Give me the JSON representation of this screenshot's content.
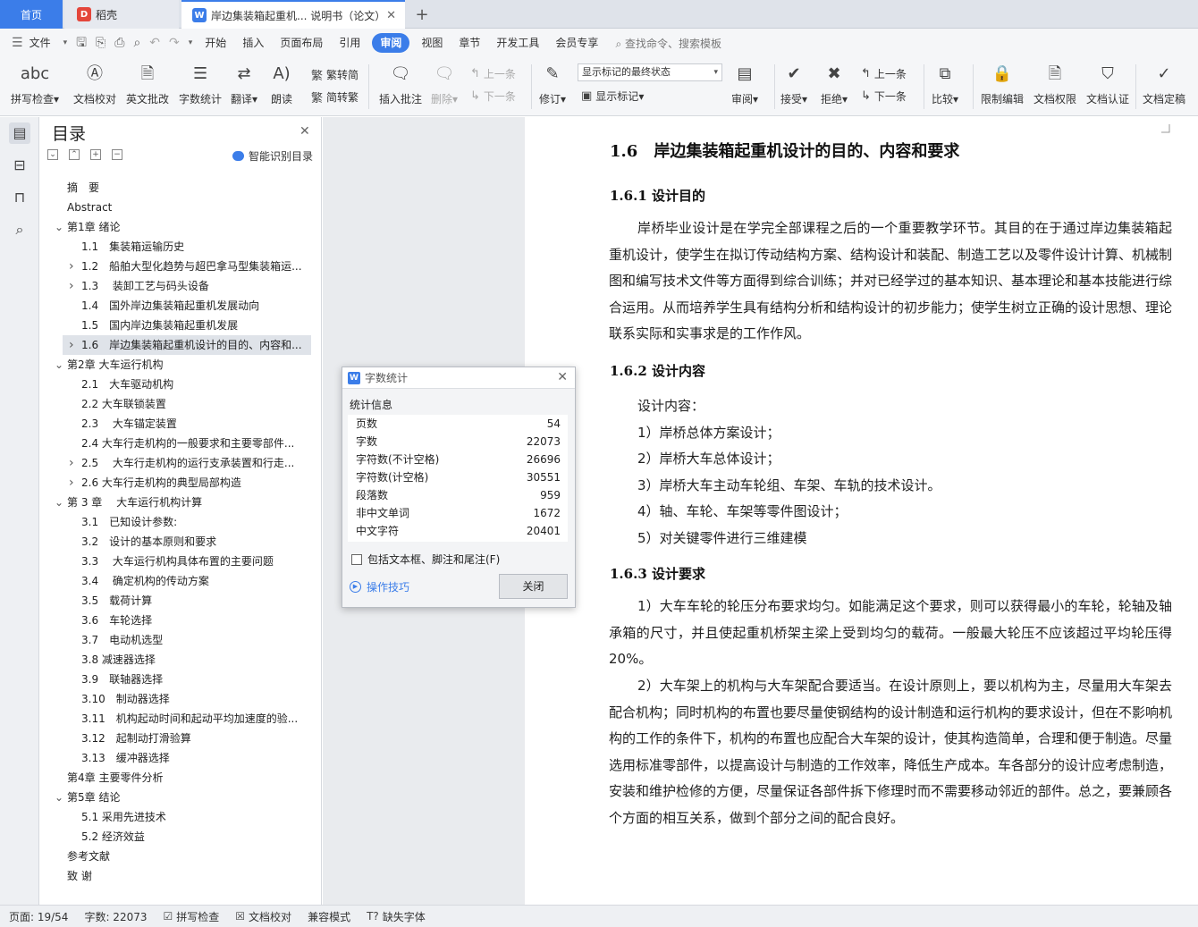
{
  "tabs": {
    "home": "首页",
    "daoke": "稻壳",
    "doc": "岸边集装箱起重机... 说明书（论文）",
    "add_icon": "plus-icon"
  },
  "menu": {
    "file": "文件",
    "items": [
      "开始",
      "插入",
      "页面布局",
      "引用",
      "审阅",
      "视图",
      "章节",
      "开发工具",
      "会员专享"
    ],
    "active": "审阅",
    "search": "查找命令、搜索模板"
  },
  "ribbon": {
    "spell": "拼写检查",
    "proof": "文档校对",
    "en_batch": "英文批改",
    "wordcount": "字数统计",
    "translate": "翻译",
    "read": "朗读",
    "trad": "繁转简",
    "simp": "简转繁",
    "insert_comment": "插入批注",
    "delete": "删除",
    "prev": "上一条",
    "next": "下一条",
    "track": "修订",
    "display_state": "显示标记的最终状态",
    "show_markup": "显示标记",
    "review": "审阅",
    "accept": "接受",
    "reject": "拒绝",
    "prev2": "上一条",
    "next2": "下一条",
    "compare": "比较",
    "restrict": "限制编辑",
    "rights": "文档权限",
    "certify": "文档认证",
    "finalize": "文档定稿"
  },
  "toc": {
    "title": "目录",
    "smart": "智能识别目录",
    "items": [
      {
        "text": "摘　要",
        "level": 0,
        "caret": ""
      },
      {
        "text": "Abstract",
        "level": 0,
        "caret": ""
      },
      {
        "text": "第1章 绪论",
        "level": 0,
        "caret": "v"
      },
      {
        "text": "1.1　集装箱运输历史",
        "level": 1,
        "caret": ""
      },
      {
        "text": "1.2　船舶大型化趋势与超巴拿马型集装箱运...",
        "level": 1,
        "caret": ">"
      },
      {
        "text": "1.3　 装卸工艺与码头设备",
        "level": 1,
        "caret": ">"
      },
      {
        "text": "1.4　国外岸边集装箱起重机发展动向",
        "level": 1,
        "caret": ""
      },
      {
        "text": "1.5　国内岸边集装箱起重机发展",
        "level": 1,
        "caret": ""
      },
      {
        "text": "1.6　岸边集装箱起重机设计的目的、内容和...",
        "level": 1,
        "caret": ">",
        "selected": true
      },
      {
        "text": "第2章 大车运行机构",
        "level": 0,
        "caret": "v"
      },
      {
        "text": "2.1　大车驱动机构",
        "level": 1,
        "caret": ""
      },
      {
        "text": "2.2 大车联锁装置",
        "level": 1,
        "caret": ""
      },
      {
        "text": "2.3　 大车锚定装置",
        "level": 1,
        "caret": ""
      },
      {
        "text": "2.4 大车行走机构的一般要求和主要零部件...",
        "level": 1,
        "caret": ""
      },
      {
        "text": "2.5　 大车行走机构的运行支承装置和行走...",
        "level": 1,
        "caret": ">"
      },
      {
        "text": "2.6 大车行走机构的典型局部构造",
        "level": 1,
        "caret": ">"
      },
      {
        "text": "第 3 章　 大车运行机构计算",
        "level": 0,
        "caret": "v"
      },
      {
        "text": "3.1　已知设计参数:",
        "level": 1,
        "caret": ""
      },
      {
        "text": "3.2　设计的基本原则和要求",
        "level": 1,
        "caret": ""
      },
      {
        "text": "3.3　 大车运行机构具体布置的主要问题",
        "level": 1,
        "caret": ""
      },
      {
        "text": "3.4　 确定机构的传动方案",
        "level": 1,
        "caret": ""
      },
      {
        "text": "3.5　载荷计算",
        "level": 1,
        "caret": ""
      },
      {
        "text": "3.6　车轮选择",
        "level": 1,
        "caret": ""
      },
      {
        "text": "3.7　电动机选型",
        "level": 1,
        "caret": ""
      },
      {
        "text": "3.8 减速器选择",
        "level": 1,
        "caret": ""
      },
      {
        "text": "3.9　联轴器选择",
        "level": 1,
        "caret": ""
      },
      {
        "text": "3.10　制动器选择",
        "level": 1,
        "caret": ""
      },
      {
        "text": "3.11　机构起动时间和起动平均加速度的验...",
        "level": 1,
        "caret": ""
      },
      {
        "text": "3.12　起制动打滑验算",
        "level": 1,
        "caret": ""
      },
      {
        "text": "3.13　缓冲器选择",
        "level": 1,
        "caret": ""
      },
      {
        "text": "第4章 主要零件分析",
        "level": 0,
        "caret": ""
      },
      {
        "text": "第5章 结论",
        "level": 0,
        "caret": "v"
      },
      {
        "text": "5.1 采用先进技术",
        "level": 1,
        "caret": ""
      },
      {
        "text": "5.2 经济效益",
        "level": 1,
        "caret": ""
      },
      {
        "text": "参考文献",
        "level": 0,
        "caret": ""
      },
      {
        "text": "致 谢",
        "level": 0,
        "caret": ""
      }
    ]
  },
  "doc": {
    "h1": "1.6　岸边集装箱起重机设计的目的、内容和要求",
    "h2a": "1.6.1 设计目的",
    "p1": "岸桥毕业设计是在学完全部课程之后的一个重要教学环节。其目的在于通过岸边集装箱起重机设计，使学生在拟订传动结构方案、结构设计和装配、制造工艺以及零件设计计算、机械制图和编写技术文件等方面得到综合训练；并对已经学过的基本知识、基本理论和基本技能进行综合运用。从而培养学生具有结构分析和结构设计的初步能力；使学生树立正确的设计思想、理论联系实际和实事求是的工作作风。",
    "h2b": "1.6.2 设计内容",
    "l0": "设计内容：",
    "l1": "1）岸桥总体方案设计；",
    "l2": "2）岸桥大车总体设计；",
    "l3": "3）岸桥大车主动车轮组、车架、车轨的技术设计。",
    "l4": "4）轴、车轮、车架等零件图设计；",
    "l5": "5）对关键零件进行三维建模",
    "h2c": "1.6.3 设计要求",
    "p2": "1）大车车轮的轮压分布要求均匀。如能满足这个要求，则可以获得最小的车轮，轮轴及轴承箱的尺寸，并且使起重机桥架主梁上受到均匀的载荷。一般最大轮压不应该超过平均轮压得 20%。",
    "p3": "2）大车架上的机构与大车架配合要适当。在设计原则上，要以机构为主，尽量用大车架去配合机构；同时机构的布置也要尽量使钢结构的设计制造和运行机构的要求设计，但在不影响机构的工作的条件下，机构的布置也应配合大车架的设计，使其构造简单，合理和便于制造。尽量选用标准零部件，以提高设计与制造的工作效率，降低生产成本。车各部分的设计应考虑制造，安装和维护检修的方便，尽量保证各部件拆下修理时而不需要移动邻近的部件。总之，要兼顾各个方面的相互关系，做到个部分之间的配合良好。"
  },
  "dialog": {
    "title": "字数统计",
    "subtitle": "统计信息",
    "rows": [
      {
        "label": "页数",
        "value": "54"
      },
      {
        "label": "字数",
        "value": "22073"
      },
      {
        "label": "字符数(不计空格)",
        "value": "26696"
      },
      {
        "label": "字符数(计空格)",
        "value": "30551"
      },
      {
        "label": "段落数",
        "value": "959"
      },
      {
        "label": "非中文单词",
        "value": "1672"
      },
      {
        "label": "中文字符",
        "value": "20401"
      }
    ],
    "checkbox": "包括文本框、脚注和尾注(F)",
    "tips": "操作技巧",
    "close": "关闭"
  },
  "status": {
    "page": "页面: 19/54",
    "words": "字数: 22073",
    "spell": "拼写检查",
    "proof": "文档校对",
    "compat": "兼容模式",
    "missing_font": "缺失字体"
  },
  "colors": {
    "accent": "#3b7de9",
    "daoke": "#e4463b"
  }
}
